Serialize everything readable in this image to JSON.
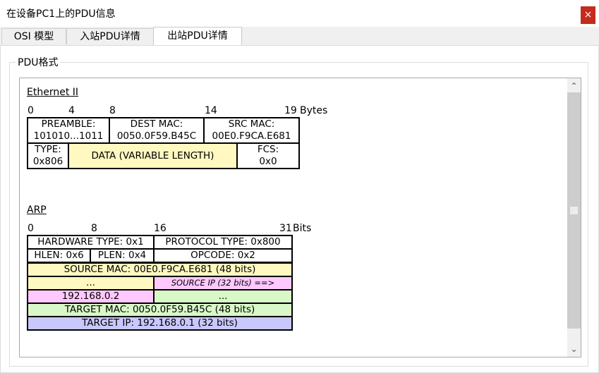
{
  "window": {
    "title": "在设备PC1上的PDU信息",
    "close_label": "×"
  },
  "tabs": [
    {
      "label": "OSI 模型",
      "active": false
    },
    {
      "label": "入站PDU详情",
      "active": false
    },
    {
      "label": "出站PDU详情",
      "active": true
    }
  ],
  "group_label": "PDU格式",
  "ethernet": {
    "title": "Ethernet II",
    "scale": {
      "n0": "0",
      "n4": "4",
      "n8": "8",
      "n14": "14",
      "n19": "19",
      "unit": "Bytes"
    },
    "preamble_label": "PREAMBLE:",
    "preamble_value": "101010...1011",
    "dest_label": "DEST MAC:",
    "dest_value": "0050.0F59.B45C",
    "src_label": "SRC MAC:",
    "src_value": "00E0.F9CA.E681",
    "type_label": "TYPE:",
    "type_value": "0x806",
    "data_label": "DATA (VARIABLE LENGTH)",
    "fcs_label": "FCS:",
    "fcs_value": "0x0"
  },
  "arp": {
    "title": "ARP",
    "scale": {
      "n0": "0",
      "n8": "8",
      "n16": "16",
      "n31": "31",
      "unit": "Bits"
    },
    "hardware_type": "HARDWARE TYPE: 0x1",
    "protocol_type": "PROTOCOL TYPE: 0x800",
    "hlen": "HLEN: 0x6",
    "plen": "PLEN: 0x4",
    "opcode": "OPCODE: 0x2",
    "source_mac": "SOURCE MAC: 00E0.F9CA.E681 (48 bits)",
    "ellipsis_left": "...",
    "source_ip_note": "SOURCE IP (32 bits) ==>",
    "source_ip_value": "192.168.0.2",
    "ellipsis_right": "...",
    "target_mac": "TARGET MAC: 0050.0F59.B45C (48 bits)",
    "target_ip": "TARGET IP: 192.168.0.1 (32 bits)"
  },
  "colors": {
    "close_button": "#c42b1c",
    "yellow_field": "#fff8c0",
    "green_field": "#d8f8c8",
    "pink_field": "#ffc8ff",
    "violet_field": "#c8c8ff"
  },
  "icons": {
    "close": "close-icon",
    "scroll_up": "chevron-up-icon",
    "scroll_down": "chevron-down-icon"
  }
}
